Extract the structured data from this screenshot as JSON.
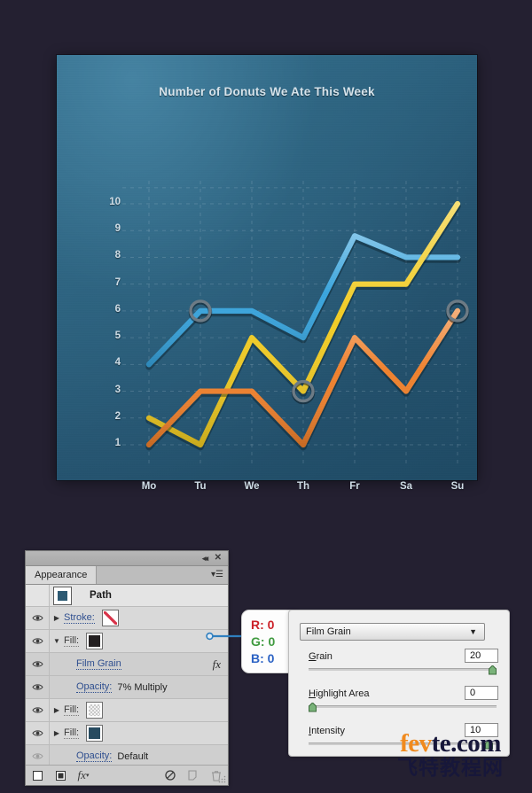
{
  "canvas": {
    "background_color": "#242031",
    "card_background_colors": [
      "#336f8e",
      "#1e4a64"
    ]
  },
  "chart_data": {
    "type": "line",
    "title": "Number of Donuts We Ate This Week",
    "xlabel": "",
    "ylabel": "",
    "categories": [
      "Mo",
      "Tu",
      "We",
      "Th",
      "Fr",
      "Sa",
      "Su"
    ],
    "ylim": [
      0,
      10.6
    ],
    "yticks": [
      1,
      2,
      3,
      4,
      5,
      6,
      7,
      8,
      9,
      10
    ],
    "grid": true,
    "grid_style": "dashed",
    "legend": "none",
    "series": [
      {
        "name": "blue",
        "color": "#36a3dd",
        "values": [
          4,
          6,
          6,
          5,
          8.8,
          8,
          8
        ]
      },
      {
        "name": "yellow",
        "color": "#f2cc22",
        "values": [
          2,
          1,
          5,
          3,
          7,
          7,
          10
        ]
      },
      {
        "name": "orange",
        "color": "#ef7f2a",
        "values": [
          1,
          3,
          3,
          1,
          5,
          3,
          6
        ]
      }
    ],
    "markers": [
      {
        "series": "blue",
        "category": "Tu",
        "value": 6
      },
      {
        "series": "yellow",
        "category": "Th",
        "value": 3
      },
      {
        "series": "orange",
        "category": "Su",
        "value": 6
      }
    ]
  },
  "panel": {
    "title_tab": "Appearance",
    "titlebar": {
      "collapse_icon": "double-left-chevron-icon",
      "close_icon": "close-icon"
    },
    "menu_icon": "panel-menu-icon",
    "rows": [
      {
        "id": "path",
        "type": "header",
        "label": "Path",
        "swatch": "path-thumbnail",
        "eye": false
      },
      {
        "id": "stroke",
        "type": "item",
        "label": "Stroke:",
        "swatch": "none",
        "triangle": "collapsed",
        "eye": true,
        "value": ""
      },
      {
        "id": "fill-1",
        "type": "item",
        "label": "Fill:",
        "swatch": "dark",
        "triangle": "expanded",
        "eye": true,
        "value": ""
      },
      {
        "id": "film-grain",
        "type": "sub",
        "label": "Film Grain",
        "fx": "fx",
        "eye": true,
        "value": ""
      },
      {
        "id": "opacity-1",
        "type": "sub",
        "label": "Opacity:",
        "value": "7% Multiply",
        "eye": true
      },
      {
        "id": "fill-2",
        "type": "item",
        "label": "Fill:",
        "swatch": "checker",
        "triangle": "collapsed",
        "eye": true,
        "value": ""
      },
      {
        "id": "fill-3",
        "type": "item",
        "label": "Fill:",
        "swatch": "blue",
        "triangle": "collapsed",
        "eye": true,
        "value": ""
      },
      {
        "id": "opacity-2",
        "type": "sub",
        "label": "Opacity:",
        "value": "Default",
        "eye": "dim"
      }
    ],
    "footer_icons": [
      "add-new-stroke-icon",
      "add-new-fill-icon",
      "add-new-effect-icon",
      "clear-appearance-icon",
      "duplicate-item-icon",
      "delete-item-icon"
    ]
  },
  "rgb_callout": {
    "r_label": "R: 0",
    "g_label": "G: 0",
    "b_label": "B: 0",
    "r_color": "#cc2229",
    "g_color": "#3f9a3f",
    "b_color": "#2b62c4"
  },
  "film_grain_dialog": {
    "effect_name": "Film Grain",
    "fields": [
      {
        "label": "Grain",
        "underline": "G",
        "value": "20",
        "slider_percent": 100
      },
      {
        "label": "Highlight Area",
        "underline": "H",
        "value": "0",
        "slider_percent": 0
      },
      {
        "label": "Intensity",
        "underline": "I",
        "value": "10",
        "slider_percent": 98
      }
    ]
  },
  "watermark": {
    "english_prefix": "fe",
    "english_accent": "v",
    "english_suffix": "te.com",
    "chinese": "飞特教程网"
  }
}
